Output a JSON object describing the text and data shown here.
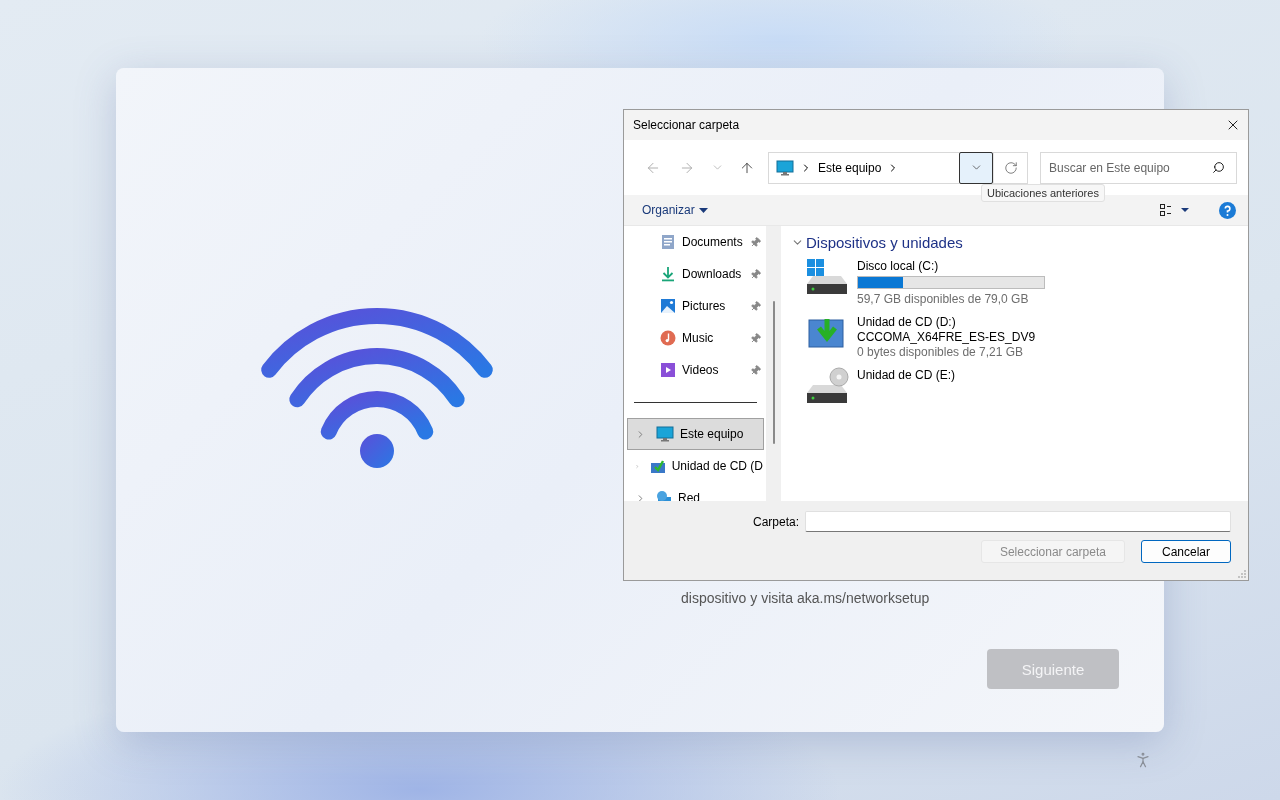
{
  "setup": {
    "message": "dispositivo y visita aka.ms/networksetup",
    "next_button": {
      "label": "Siguiente",
      "disabled": true
    }
  },
  "dialog": {
    "title": "Seleccionar carpeta",
    "address": {
      "path": [
        "Este equipo"
      ]
    },
    "history_tooltip": "Ubicaciones anteriores",
    "search": {
      "placeholder": "Buscar en Este equipo"
    },
    "organize": "Organizar",
    "quick_access": [
      {
        "label": "Documents",
        "kind": "documents",
        "pinned": true
      },
      {
        "label": "Downloads",
        "kind": "downloads",
        "pinned": true
      },
      {
        "label": "Pictures",
        "kind": "pictures",
        "pinned": true
      },
      {
        "label": "Music",
        "kind": "music",
        "pinned": true
      },
      {
        "label": "Videos",
        "kind": "videos",
        "pinned": true
      }
    ],
    "tree": [
      {
        "label": "Este equipo",
        "kind": "pc",
        "selected": true
      },
      {
        "label": "Unidad de CD (D",
        "kind": "dvd",
        "selected": false
      },
      {
        "label": "Red",
        "kind": "network",
        "selected": false
      }
    ],
    "section": {
      "title": "Dispositivos y unidades",
      "expanded": true
    },
    "drives": [
      {
        "name": "Disco local (C:)",
        "kind": "system",
        "level": 0.244,
        "free": "59,7 GB disponibles de 79,0 GB"
      },
      {
        "name": "Unidad de CD (D:)",
        "kind": "dvd",
        "volume": "CCCOMA_X64FRE_ES-ES_DV9",
        "free": "0 bytes disponibles de 7,21 GB"
      },
      {
        "name": "Unidad de CD (E:)",
        "kind": "cd"
      }
    ],
    "folder_label": "Carpeta:",
    "buttons": [
      {
        "label": "Seleccionar carpeta",
        "disabled": true,
        "default": false
      },
      {
        "label": "Cancelar",
        "disabled": false,
        "default": true
      }
    ]
  }
}
